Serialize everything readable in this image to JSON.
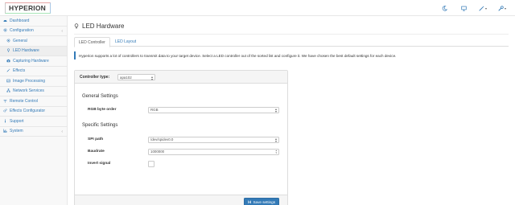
{
  "header": {
    "logo_text": "HYPERION",
    "icons": [
      "moon-icon",
      "monitor-icon",
      "wand-icon",
      "wrench-icon"
    ]
  },
  "sidebar": {
    "items": [
      {
        "label": "Dashboard",
        "icon": "dashboard-icon"
      },
      {
        "label": "Configuration",
        "icon": "gear-icon",
        "expandable": true
      },
      {
        "label": "General",
        "icon": "gear-icon"
      },
      {
        "label": "LED Hardware",
        "icon": "lightbulb-icon"
      },
      {
        "label": "Capturing Hardware",
        "icon": "camera-icon"
      },
      {
        "label": "Effects",
        "icon": "magic-icon"
      },
      {
        "label": "Image Processing",
        "icon": "image-icon"
      },
      {
        "label": "Network Services",
        "icon": "network-icon"
      },
      {
        "label": "Remote Control",
        "icon": "wifi-icon"
      },
      {
        "label": "Effects Configurator",
        "icon": "cogs-icon"
      },
      {
        "label": "Support",
        "icon": "info-icon"
      },
      {
        "label": "System",
        "icon": "chart-icon",
        "expandable": true
      }
    ]
  },
  "page": {
    "title": "LED Hardware",
    "tabs": [
      {
        "label": "LED Controller",
        "active": true
      },
      {
        "label": "LED Layout",
        "active": false
      }
    ],
    "info_text": "Hyperion supports a lot of controllers to transmit data to your target device. Select a LED controller out of the sorted list and configure it. We have chosen the best default settings for each device."
  },
  "panel": {
    "controller_label": "Controller type:",
    "controller_value": "apa102",
    "general_heading": "General Settings",
    "rgb_label": "RGB byte order",
    "rgb_value": "RGB",
    "specific_heading": "Specific Settings",
    "spi_label": "SPI path",
    "spi_value": "/dev/spidev0.0",
    "baud_label": "Baudrate",
    "baud_value": "1000000",
    "invert_label": "Invert signal",
    "invert_checked": false,
    "save_label": "Save settings"
  },
  "colors": {
    "link": "#337ab7",
    "button": "#337ab7",
    "sidebar_bg": "#f8f8f8"
  }
}
